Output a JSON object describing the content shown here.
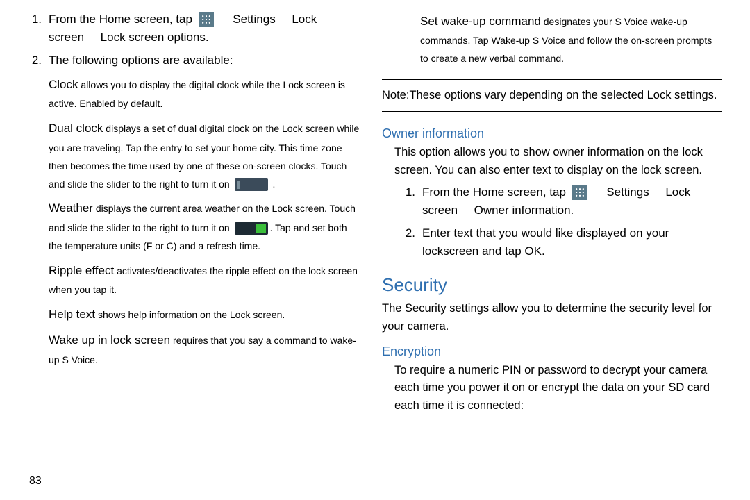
{
  "left": {
    "step1": {
      "num": "1.",
      "pre": "From the Home screen, tap",
      "post1": "Settings",
      "post2": "Lock",
      "line2a": "screen",
      "line2b": "Lock screen options"
    },
    "step2": {
      "num": "2.",
      "text": "The following options are available:"
    },
    "clock": {
      "lead": "Clock",
      "rest": " allows you to display the digital clock while the Lock screen is active. Enabled by default."
    },
    "dual": {
      "lead": "Dual clock",
      "rest": " displays a set of dual digital clock on the Lock screen while you are traveling. Tap the entry to set your home city. This time zone then becomes the time used by one of these on-screen clocks. Touch and slide the slider to the right to turn it on "
    },
    "weather": {
      "lead": "Weather",
      "rest1": " displays the current area weather on the Lock screen. Touch and slide the slider to the right to turn it on ",
      "rest2": ". Tap and set both the temperature units (F or C) and a refresh time."
    },
    "ripple": {
      "lead": "Ripple effect",
      "rest": " activates/deactivates the ripple effect on the lock screen when you tap it."
    },
    "help": {
      "lead": "Help text",
      "rest": " shows help information on the Lock screen."
    },
    "wake": {
      "lead": "Wake up in lock screen",
      "rest": " requires that you say a command to wake-up S Voice."
    }
  },
  "right": {
    "setwake": {
      "lead": "Set wake-up command",
      "rest": " designates your S Voice wake-up commands. Tap Wake-up S Voice and follow the on-screen prompts to create a new verbal command."
    },
    "note": {
      "label": "Note:",
      "text": "These options vary depending on the selected Lock settings."
    },
    "owner_heading": "Owner information",
    "owner_text": "This option allows you to show owner information on the lock screen. You can also enter text to display on the lock screen.",
    "owner_step1": {
      "num": "1.",
      "pre": "From the Home screen, tap",
      "post1": "Settings",
      "post2": "Lock",
      "line2a": "screen",
      "line2b": "Owner information"
    },
    "owner_step2": {
      "num": "2.",
      "text": "Enter text that you would like displayed on your lockscreen and tap OK."
    },
    "security_heading": "Security",
    "security_text": "The Security settings allow you to determine the security level for your camera.",
    "encryption_heading": "Encryption",
    "encryption_text": "To require a numeric PIN or password to decrypt your camera each time you power it on or encrypt the data on your SD card each time it is connected:"
  },
  "page_number": "83"
}
